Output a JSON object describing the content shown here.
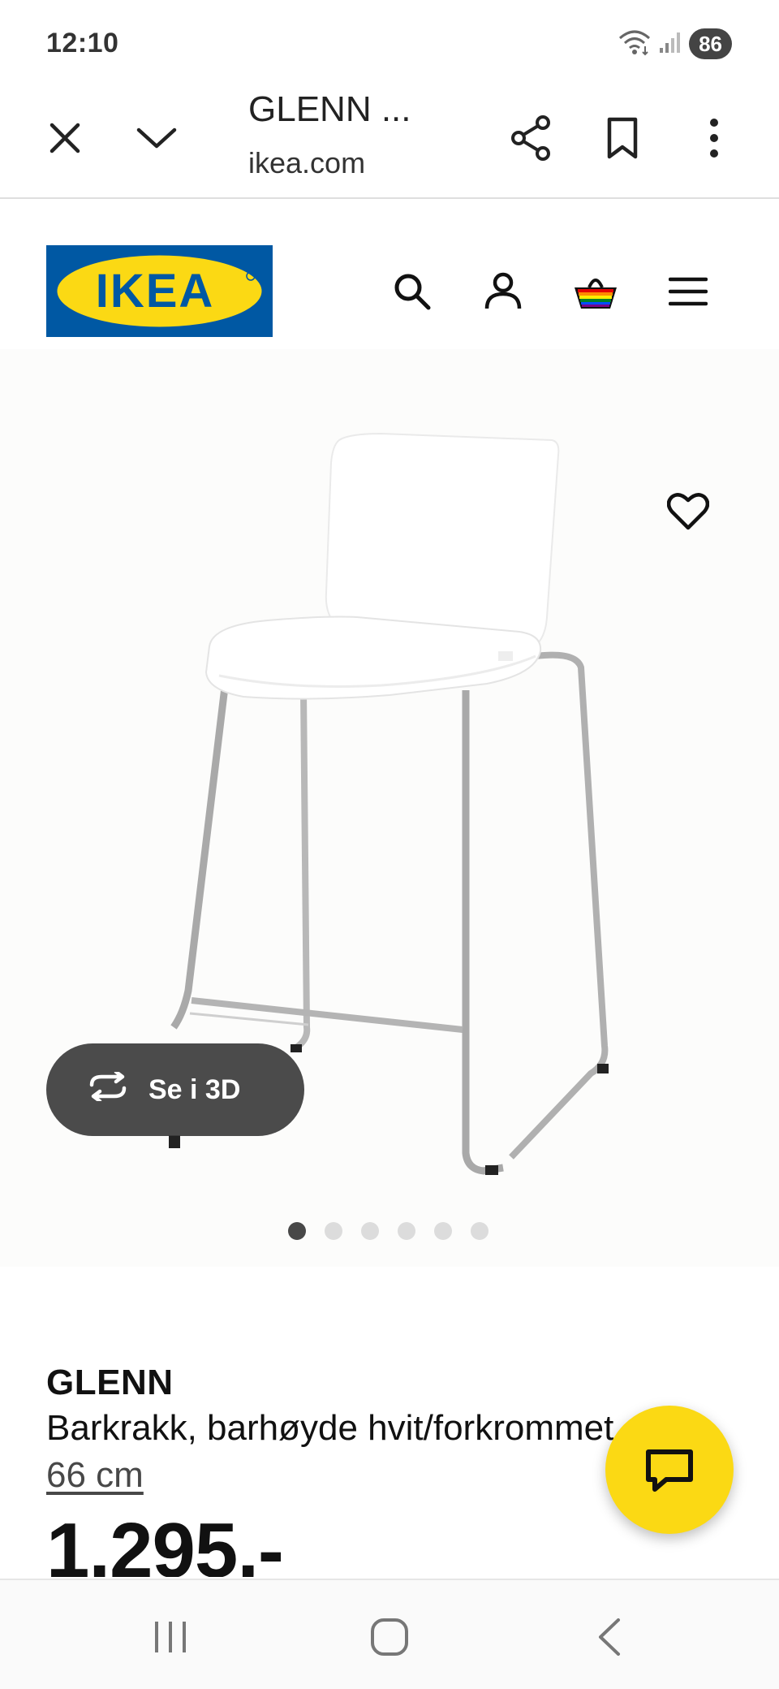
{
  "status_bar": {
    "time": "12:10",
    "battery": "86",
    "icons": [
      "wifi-icon",
      "signal-icon"
    ]
  },
  "browser": {
    "tab_title": "GLENN ...",
    "url": "ikea.com",
    "icons": [
      "close-icon",
      "chevron-down-icon",
      "share-icon",
      "bookmark-icon",
      "more-vert-icon"
    ]
  },
  "header": {
    "logo_text": "IKEA",
    "icons": [
      "search-icon",
      "account-icon",
      "cart-icon",
      "menu-icon"
    ],
    "logo_colors": {
      "blue": "#0058a3",
      "yellow": "#fbd914"
    }
  },
  "gallery": {
    "view_3d_label": "Se i 3D",
    "total_images": 6,
    "active_index": 0
  },
  "product": {
    "name": "GLENN",
    "description": "Barkrakk, barhøyde hvit/forkrommet",
    "size_link": "66 cm",
    "price": "1.295,-"
  },
  "colors": {
    "accent_yellow": "#fbd914",
    "ikea_blue": "#0058a3"
  }
}
